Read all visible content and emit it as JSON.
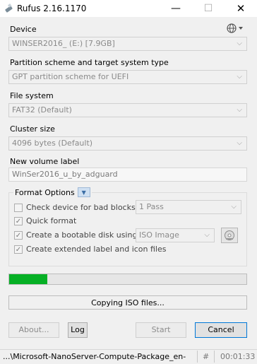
{
  "window": {
    "title": "Rufus 2.16.1170"
  },
  "device": {
    "label": "Device",
    "value": "WINSER2016_ (E:) [7.9GB]"
  },
  "partition": {
    "label": "Partition scheme and target system type",
    "value": "GPT partition scheme for UEFI"
  },
  "filesystem": {
    "label": "File system",
    "value": "FAT32 (Default)"
  },
  "cluster": {
    "label": "Cluster size",
    "value": "4096 bytes (Default)"
  },
  "volume": {
    "label": "New volume label",
    "value": "WinSer2016_u_by_adguard"
  },
  "format_options": {
    "title": "Format Options",
    "bad_blocks": {
      "label": "Check device for bad blocks",
      "checked": false,
      "passes": "1 Pass"
    },
    "quick_format": {
      "label": "Quick format",
      "checked": true
    },
    "bootable": {
      "label": "Create a bootable disk using",
      "checked": true,
      "type": "ISO Image"
    },
    "extended_label": {
      "label": "Create extended label and icon files",
      "checked": true
    }
  },
  "progress": {
    "percent": 16
  },
  "status": {
    "text": "Copying ISO files..."
  },
  "buttons": {
    "about": "About...",
    "log": "Log",
    "start": "Start",
    "cancel": "Cancel"
  },
  "footer": {
    "file": "...\\Microsoft-NanoServer-Compute-Package_en-",
    "hash": "#",
    "elapsed": "00:01:33"
  },
  "colors": {
    "progress": "#06b025",
    "accent": "#0078d7"
  }
}
